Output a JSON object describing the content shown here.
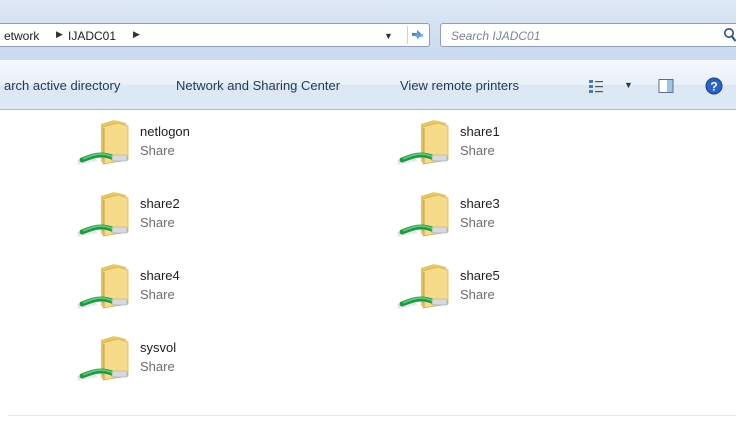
{
  "address_bar": {
    "breadcrumbs": [
      "etwork",
      "IJADC01"
    ],
    "search_placeholder": "Search IJADC01"
  },
  "command_bar": {
    "items": [
      "arch active directory",
      "Network and Sharing Center",
      "View remote printers"
    ]
  },
  "shares": [
    {
      "name": "netlogon",
      "type": "Share"
    },
    {
      "name": "share1",
      "type": "Share"
    },
    {
      "name": "share2",
      "type": "Share"
    },
    {
      "name": "share3",
      "type": "Share"
    },
    {
      "name": "share4",
      "type": "Share"
    },
    {
      "name": "share5",
      "type": "Share"
    },
    {
      "name": "sysvol",
      "type": "Share"
    }
  ],
  "icons": {
    "share_folder": "network-share-folder-icon",
    "refresh": "refresh-icon",
    "search": "search-icon",
    "views": "change-view-icon",
    "preview": "preview-pane-icon",
    "help": "help-icon"
  },
  "colors": {
    "chrome": "#d3e1f1",
    "command_text": "#1e395b",
    "folder": "#f1d37a",
    "cable": "#2aa84a",
    "help": "#2a62c8"
  }
}
